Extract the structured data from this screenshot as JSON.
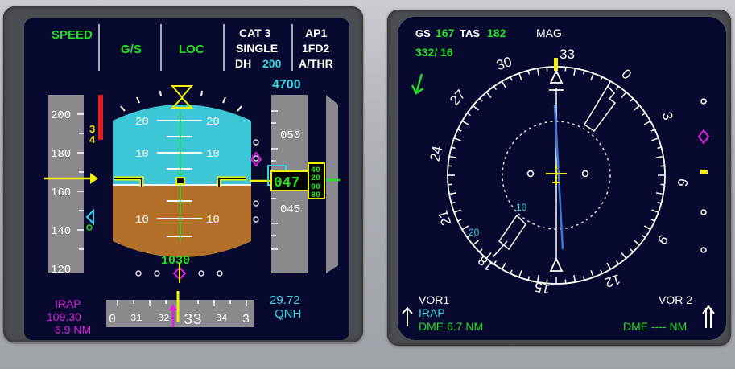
{
  "colors": {
    "green": "#22e022",
    "white": "#ffffff",
    "cyan": "#38d8e8",
    "magenta": "#e020e0",
    "yellow": "#f0f000",
    "amber": "#f0e000",
    "red": "#ff2020",
    "sky": "#3cc6d6",
    "ground": "#b3702a",
    "screen": "#070a2e"
  },
  "pfd": {
    "fma": {
      "speed": "SPEED",
      "vertical": "G/S",
      "lateral": "LOC",
      "cat": "CAT 3",
      "single": "SINGLE",
      "dh_label": "DH",
      "dh_value": "200",
      "ap": "AP1",
      "fd": "1FD2",
      "athr": "A/THR"
    },
    "speed_tape": {
      "labels": [
        "200",
        "180",
        "160",
        "140",
        "120"
      ],
      "speed_trend_3": "3",
      "speed_trend_4": "4"
    },
    "attitude": {
      "pitch_labels": [
        "20",
        "20",
        "10",
        "10",
        "10",
        "10"
      ],
      "radio_alt": "1030"
    },
    "altitude_tape": {
      "selected_alt": "4700",
      "labels": [
        "050",
        "045"
      ],
      "current_hundreds": "047",
      "drum_values": [
        "40",
        "20",
        "00",
        "80"
      ]
    },
    "ils": {
      "identifier": "IRAP",
      "frequency": "109.30",
      "distance": "6.9 NM"
    },
    "heading_tape": {
      "labels": [
        "0",
        "31",
        "32",
        "33",
        "34",
        "3"
      ],
      "current": "33"
    },
    "baro": {
      "value": "29.72",
      "unit": "QNH"
    }
  },
  "nd": {
    "gs_label": "GS",
    "gs_value": "167",
    "tas_label": "TAS",
    "tas_value": "182",
    "wind": "332/ 16",
    "mode": "MAG",
    "compass_labels": {
      "n33": "33",
      "n0": "0",
      "n3": "3",
      "n6": "6",
      "n9": "9",
      "n12": "12",
      "n15": "15",
      "n18": "18",
      "n21": "21",
      "n24": "24",
      "n27": "27",
      "n30": "30"
    },
    "range_labels": [
      "10",
      "20"
    ],
    "vor1": {
      "label": "VOR1",
      "ident": "IRAP",
      "dme": "DME 6.7 NM"
    },
    "vor2": {
      "label": "VOR 2",
      "dme": "DME ---- NM"
    }
  }
}
